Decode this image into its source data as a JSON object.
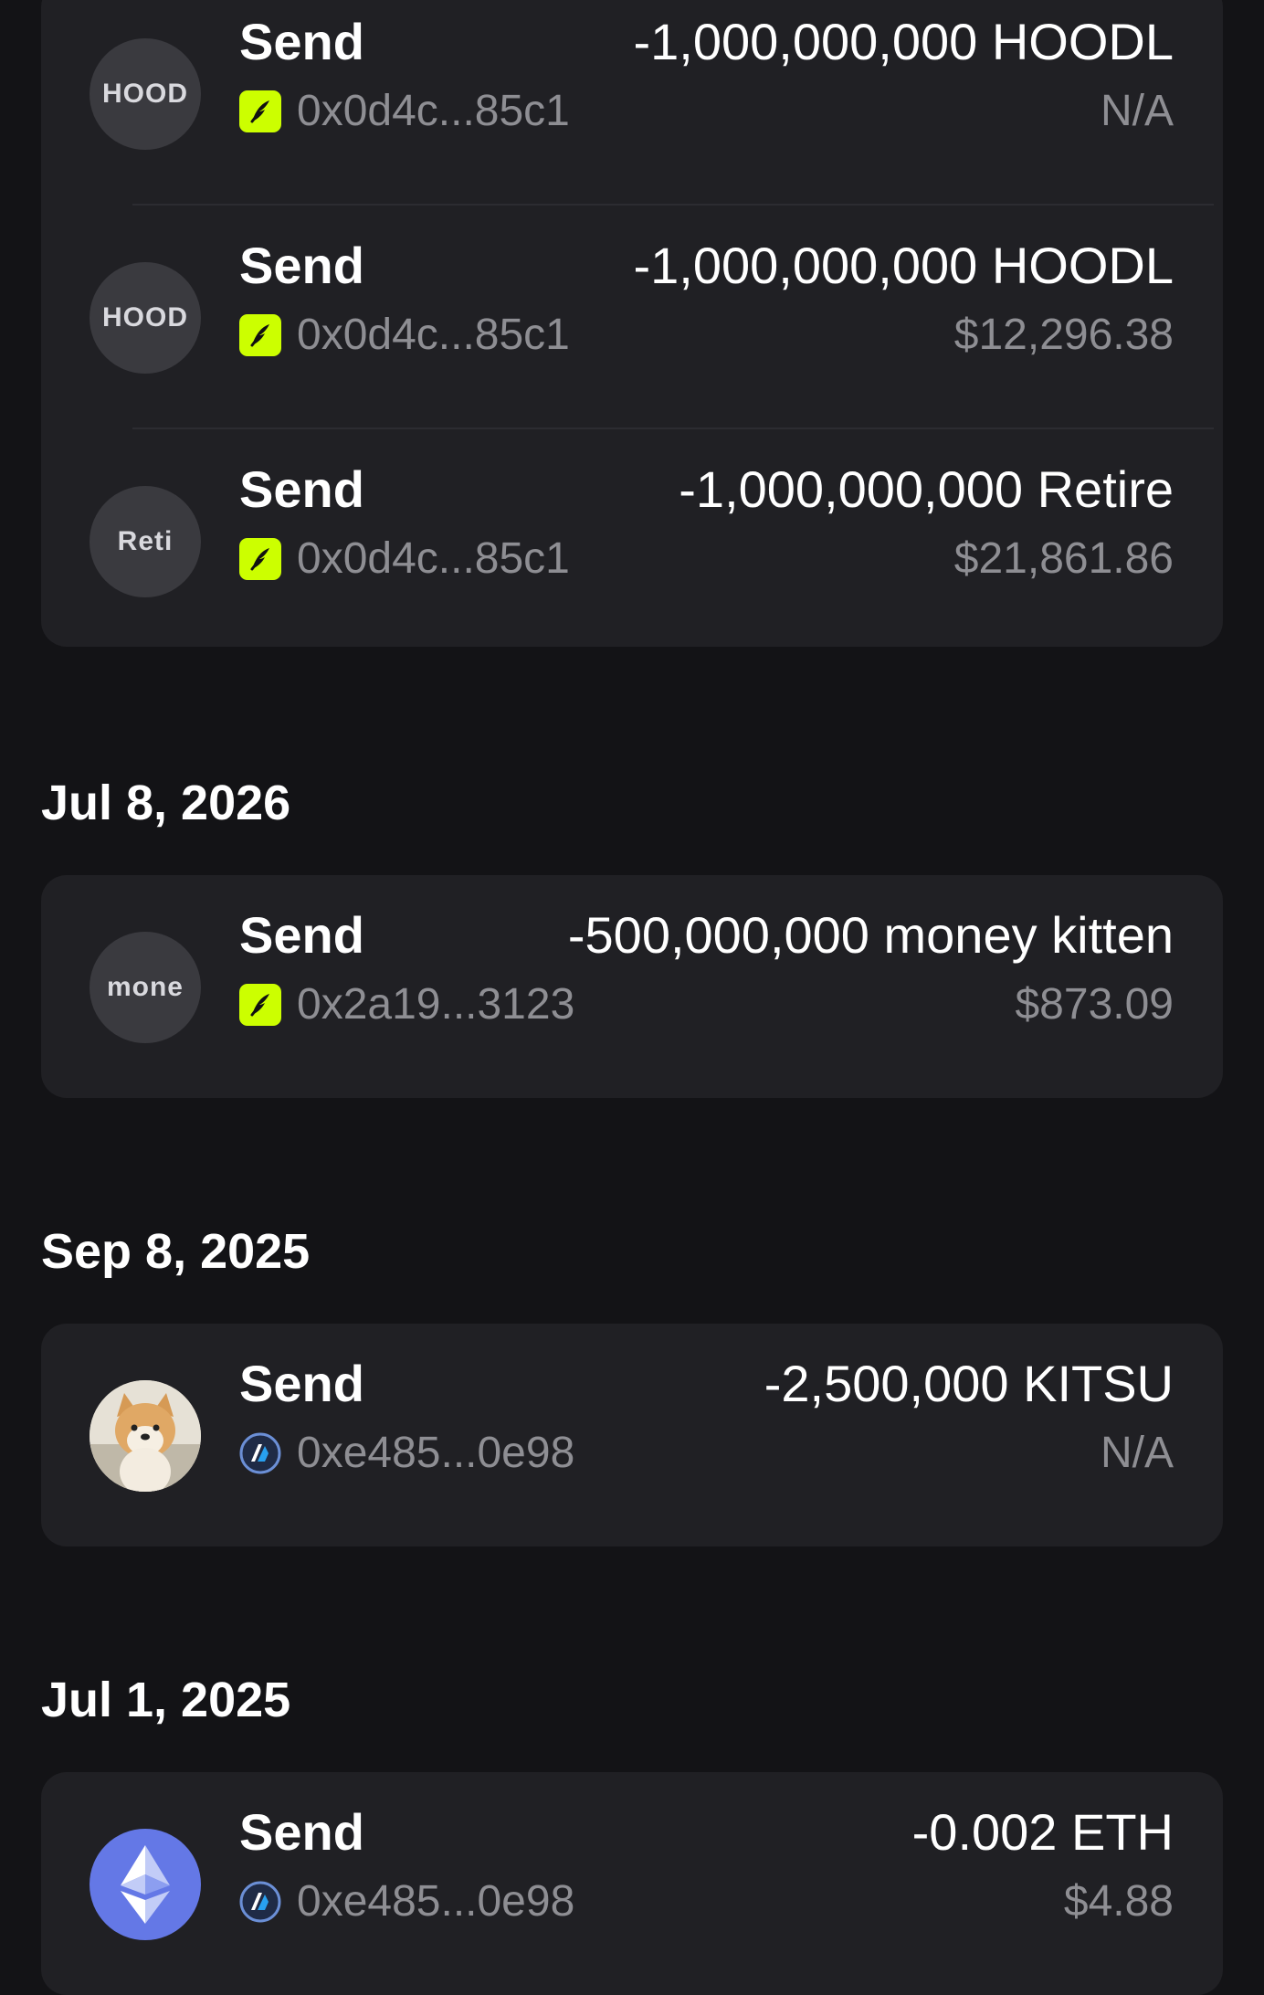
{
  "groups": [
    {
      "date": "",
      "transactions": [
        {
          "avatar_text": "HOOD",
          "type": "Send",
          "address": "0x0d4c...85c1",
          "amount": "-1,000,000,000 HOODL",
          "value": "N/A",
          "chain_icon": "robinhood-chain-icon"
        },
        {
          "avatar_text": "HOOD",
          "type": "Send",
          "address": "0x0d4c...85c1",
          "amount": "-1,000,000,000 HOODL",
          "value": "$12,296.38",
          "chain_icon": "robinhood-chain-icon"
        },
        {
          "avatar_text": "Reti",
          "type": "Send",
          "address": "0x0d4c...85c1",
          "amount": "-1,000,000,000 Retire",
          "value": "$21,861.86",
          "chain_icon": "robinhood-chain-icon"
        }
      ]
    },
    {
      "date": "Jul 8, 2026",
      "transactions": [
        {
          "avatar_text": "mone",
          "type": "Send",
          "address": "0x2a19...3123",
          "amount": "-500,000,000 money kitten",
          "value": "$873.09",
          "chain_icon": "robinhood-chain-icon"
        }
      ]
    },
    {
      "date": "Sep 8, 2025",
      "transactions": [
        {
          "avatar_icon": "shiba-dog-avatar-icon",
          "type": "Send",
          "address": "0xe485...0e98",
          "amount": "-2,500,000 KITSU",
          "value": "N/A",
          "chain_icon": "arbitrum-chain-icon"
        }
      ]
    },
    {
      "date": "Jul 1, 2025",
      "transactions": [
        {
          "avatar_icon": "ethereum-logo-icon",
          "type": "Send",
          "address": "0xe485...0e98",
          "amount": "-0.002 ETH",
          "value": "$4.88",
          "chain_icon": "arbitrum-chain-icon"
        }
      ]
    }
  ],
  "colors": {
    "background": "#131316",
    "card": "#202024",
    "text_primary": "#ffffff",
    "text_secondary": "#8e8e93",
    "robinhood_green": "#ccff00",
    "eth_blue": "#6478e6"
  }
}
